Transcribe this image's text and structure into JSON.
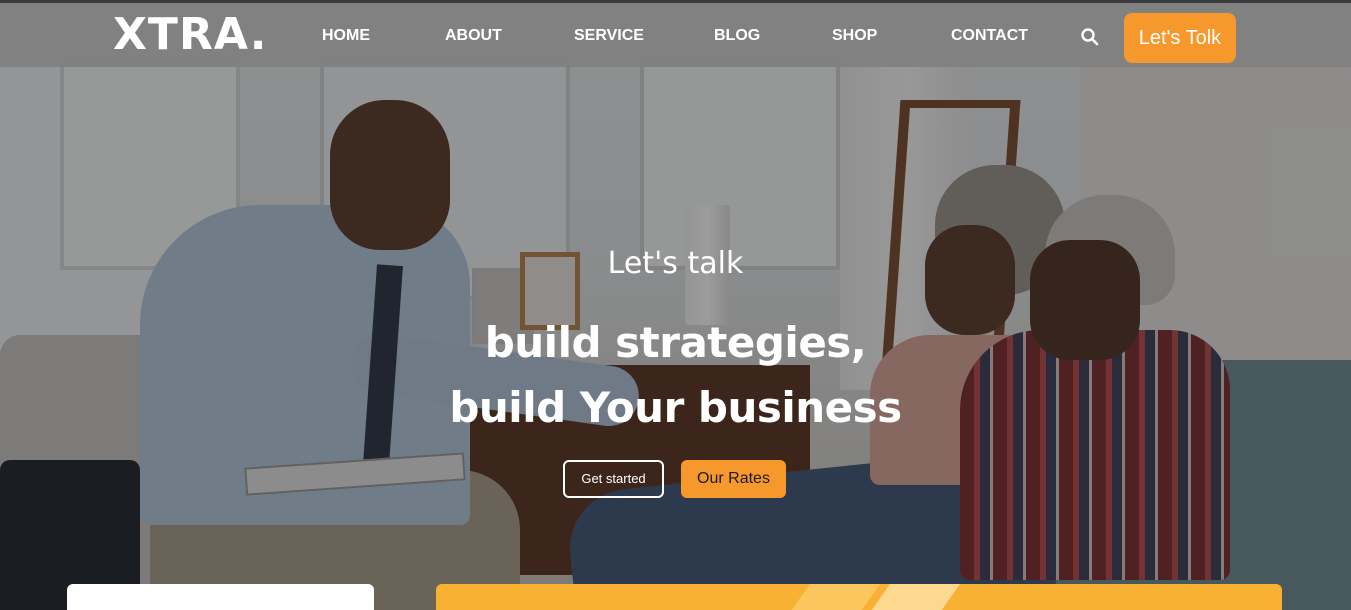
{
  "brand": {
    "logo_text": "XTRA."
  },
  "nav": {
    "items": [
      {
        "label": "HOME"
      },
      {
        "label": "ABOUT"
      },
      {
        "label": "SERVICE"
      },
      {
        "label": "BLOG"
      },
      {
        "label": "SHOP"
      },
      {
        "label": "CONTACT"
      }
    ],
    "search_icon": "search-icon",
    "cta_label": "Let's Tolk"
  },
  "hero": {
    "eyebrow": "Let's talk",
    "headline_line1": "build strategies,",
    "headline_line2": "build Your business",
    "primary_button": "Get started",
    "secondary_button": "Our Rates"
  },
  "colors": {
    "accent": "#f7982d",
    "header_bg": "#808080",
    "card_orange": "#f9b134",
    "text_light": "#ffffff"
  }
}
